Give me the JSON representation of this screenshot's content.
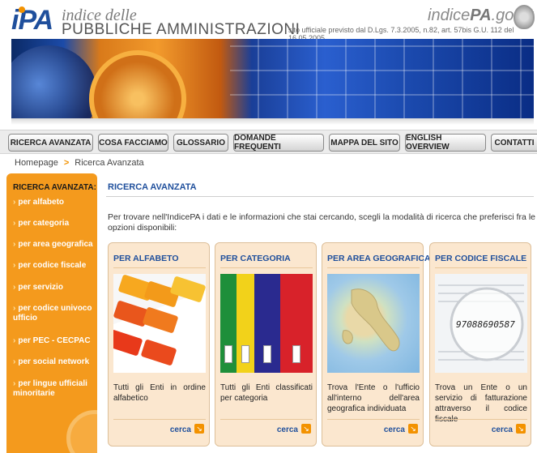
{
  "header": {
    "logo_i": "i",
    "logo_pa": "PA",
    "title_line1": "indice delle",
    "title_line2": "PUBBLICHE AMMINISTRAZIONI",
    "site_name_a": "indice",
    "site_name_b": "PA",
    "site_name_c": ".gov.it",
    "legal": "sito ufficiale previsto dal D.Lgs. 7.3.2005, n.82, art. 57bis G.U. 112 del 16.05.2005"
  },
  "nav": {
    "items": [
      {
        "label": "RICERCA AVANZATA"
      },
      {
        "label": "COSA FACCIAMO"
      },
      {
        "label": "GLOSSARIO"
      },
      {
        "label": "DOMANDE FREQUENTI"
      },
      {
        "label": "MAPPA DEL SITO"
      },
      {
        "label": "ENGLISH OVERVIEW"
      },
      {
        "label": "CONTATTI"
      }
    ]
  },
  "breadcrumb": {
    "home": "Homepage",
    "separator": ">",
    "current": "Ricerca Avanzata"
  },
  "sidebar": {
    "title": "RICERCA AVANZATA:",
    "items": [
      {
        "label": "per alfabeto"
      },
      {
        "label": "per categoria"
      },
      {
        "label": "per area geografica"
      },
      {
        "label": "per codice fiscale"
      },
      {
        "label": "per servizio"
      },
      {
        "label": "per codice univoco ufficio"
      },
      {
        "label": "per PEC - CECPAC"
      },
      {
        "label": "per social network"
      },
      {
        "label": "per lingue ufficiali minoritarie"
      }
    ]
  },
  "main": {
    "title": "RICERCA AVANZATA",
    "intro": "Per trovare nell'IndicePA i dati e le informazioni che stai cercando, scegli la modalità di ricerca che preferisci fra le opzioni disponibili:",
    "cards": [
      {
        "title": "PER ALFABETO",
        "text": "Tutti gli Enti in ordine alfabetico",
        "cta": "cerca",
        "image": "alphabet-tabs-photo"
      },
      {
        "title": "PER CATEGORIA",
        "text": "Tutti gli Enti classificati per categoria",
        "cta": "cerca",
        "image": "colored-binders-photo"
      },
      {
        "title": "PER AREA GEOGRAFICA",
        "text": "Trova l'Ente o l'ufficio all'interno dell'area geografica individuata",
        "cta": "cerca",
        "image": "italy-map-photo"
      },
      {
        "title": "PER CODICE FISCALE",
        "text": "Trova un Ente o un servizio di fatturazione attraverso il codice fiscale",
        "cta": "cerca",
        "image": "tax-code-document-photo",
        "code_sample": "97088690587"
      }
    ]
  },
  "colors": {
    "brand_blue": "#1f4f9c",
    "brand_orange": "#f39200",
    "sidebar_orange": "#f49a1d",
    "card_bg": "#fbe7cf"
  }
}
